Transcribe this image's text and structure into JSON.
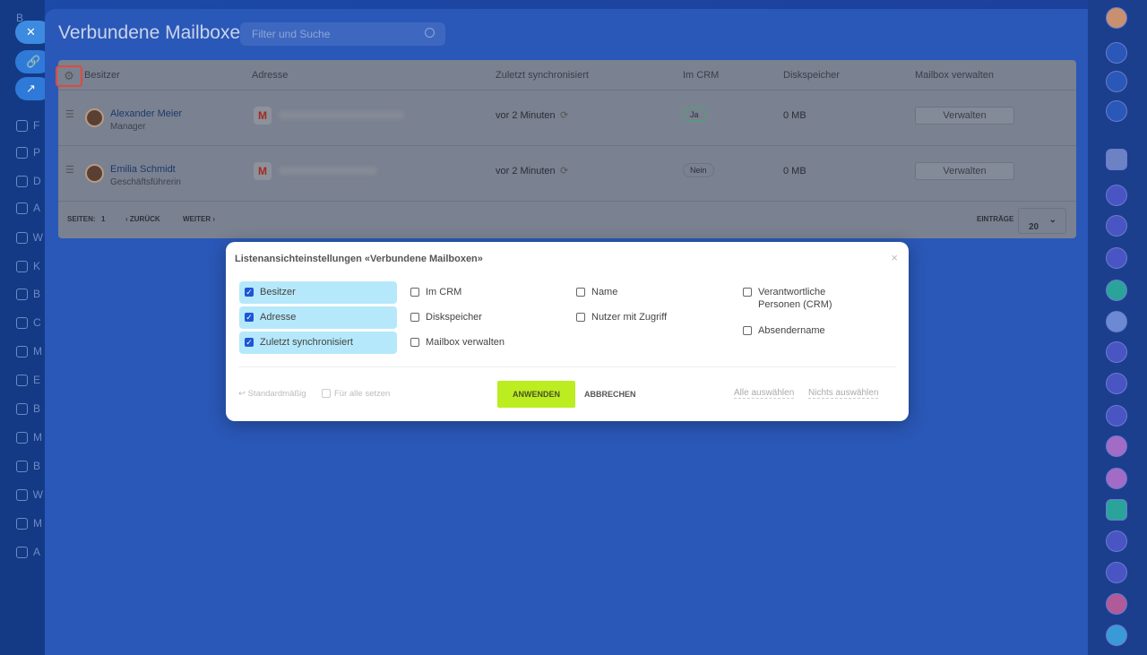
{
  "left_nav": {
    "items": [
      "B",
      "F",
      "P",
      "D",
      "A",
      "W",
      "K",
      "B",
      "C",
      "M",
      "E",
      "B",
      "M",
      "B",
      "W",
      "M",
      "A"
    ]
  },
  "page": {
    "title": "Verbundene Mailboxen",
    "search_placeholder": "Filter und Suche"
  },
  "grid": {
    "columns": [
      "Besitzer",
      "Adresse",
      "Zuletzt synchronisiert",
      "Im CRM",
      "Diskspeicher",
      "Mailbox verwalten"
    ],
    "rows": [
      {
        "name": "Alexander Meier",
        "role": "Manager",
        "synced": "vor 2 Minuten",
        "crm": "Ja",
        "disk": "0 MB",
        "action": "Verwalten"
      },
      {
        "name": "Emilia Schmidt",
        "role": "Geschäftsführerin",
        "synced": "vor 2 Minuten",
        "crm": "Nein",
        "disk": "0 MB",
        "action": "Verwalten"
      }
    ],
    "footer": {
      "pages_label": "SEITEN:",
      "page": "1",
      "prev": "ZURÜCK",
      "next": "WEITER",
      "entries_label": "EINTRÄGE",
      "entries_value": "20"
    }
  },
  "modal": {
    "title": "Listenansichteinstellungen «Verbundene Mailboxen»",
    "close": "×",
    "options": [
      {
        "label": "Besitzer",
        "checked": true
      },
      {
        "label": "Adresse",
        "checked": true
      },
      {
        "label": "Zuletzt synchronisiert",
        "checked": true
      },
      {
        "label": "Im CRM",
        "checked": false
      },
      {
        "label": "Diskspeicher",
        "checked": false
      },
      {
        "label": "Mailbox verwalten",
        "checked": false
      },
      {
        "label": "Name",
        "checked": false
      },
      {
        "label": "Nutzer mit Zugriff",
        "checked": false
      },
      {
        "label": "Verantwortliche Personen (CRM)",
        "checked": false
      },
      {
        "label": "Absendername",
        "checked": false
      }
    ],
    "reset": "↩ Standardmäßig",
    "for_all": "Für alle setzen",
    "apply": "ANWENDEN",
    "cancel": "ABBRECHEN",
    "select_all": "Alle auswählen",
    "select_none": "Nichts auswählen"
  }
}
